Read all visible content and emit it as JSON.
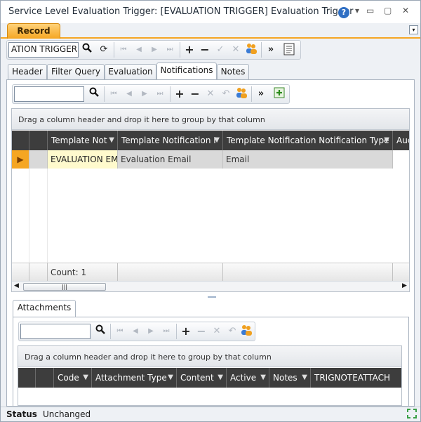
{
  "window": {
    "title": "Service Level Evaluation Trigger: [EVALUATION TRIGGER] Evaluation Trigger",
    "help_label": "?",
    "dropdown_glyph": "▾",
    "minimize_glyph": "▭",
    "maximize_glyph": "▢",
    "close_glyph": "✕"
  },
  "record_tab": {
    "label": "Record",
    "collapse_glyph": "▾"
  },
  "record_toolbar": {
    "search_value": "ATION TRIGGER"
  },
  "tabs": [
    {
      "label": "Header"
    },
    {
      "label": "Filter Query"
    },
    {
      "label": "Evaluation"
    },
    {
      "label": "Notifications"
    },
    {
      "label": "Notes"
    }
  ],
  "notifications": {
    "search_value": "",
    "group_hint": "Drag a column header and drop it here to group by that column",
    "columns": [
      "Template Not",
      "Template Notification I",
      "Template Notification Notification Type",
      "Auc"
    ],
    "rows": [
      [
        "EVALUATION EMA",
        "Evaluation Email",
        "Email",
        ""
      ]
    ],
    "count_label": "Count: 1"
  },
  "attachments": {
    "tab_label": "Attachments",
    "search_value": "",
    "group_hint": "Drag a column header and drop it here to group by that column",
    "columns": [
      "Code",
      "Attachment Type",
      "Content",
      "Active",
      "Notes",
      "TRIGNOTEATTACH"
    ]
  },
  "status": {
    "label": "Status",
    "value": "Unchanged"
  },
  "icons": {
    "search": "search-icon",
    "refresh": "refresh-icon",
    "first": "first-record-icon",
    "prev": "previous-record-icon",
    "next": "next-record-icon",
    "last": "last-record-icon",
    "add": "add-icon",
    "remove": "remove-icon",
    "accept": "accept-icon",
    "cancel": "cancel-icon",
    "users": "users-icon",
    "more": "more-icon",
    "notes": "notes-icon",
    "undo": "undo-icon",
    "add_row": "add-row-icon",
    "row_indicator": "row-indicator-icon",
    "resize_grip": "resize-grip-icon"
  },
  "colors": {
    "accent_orange": "#f5a623",
    "header_dark": "#3d3d3d",
    "selected_cell": "#fffacd",
    "help_blue": "#2f6fc4"
  }
}
